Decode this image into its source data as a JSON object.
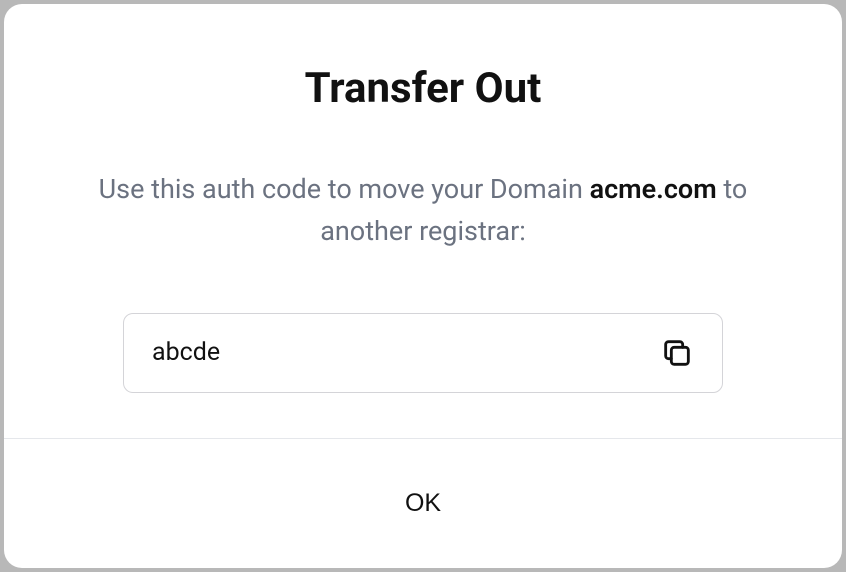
{
  "modal": {
    "title": "Transfer Out",
    "description_prefix": "Use this auth code to move your Domain ",
    "domain": "acme.com",
    "description_suffix": " to another registrar:",
    "auth_code": "abcde",
    "ok_label": "OK"
  }
}
